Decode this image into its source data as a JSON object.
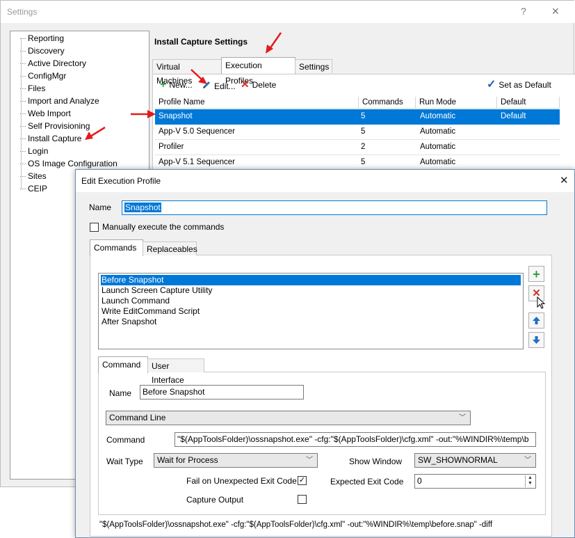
{
  "settings_window": {
    "title": "Settings",
    "help_glyph": "?",
    "close_glyph": "✕",
    "tree_items": [
      {
        "label": "Reporting"
      },
      {
        "label": "Discovery"
      },
      {
        "label": "Active Directory"
      },
      {
        "label": "ConfigMgr"
      },
      {
        "label": "Files"
      },
      {
        "label": "Import and Analyze"
      },
      {
        "label": "Web Import"
      },
      {
        "label": "Self Provisioning"
      },
      {
        "label": "Install Capture"
      },
      {
        "label": "Login"
      },
      {
        "label": "OS Image Configuration"
      },
      {
        "label": "Sites"
      },
      {
        "label": "CEIP"
      }
    ],
    "section_title": "Install Capture Settings",
    "tabs": [
      {
        "label": "Virtual Machines"
      },
      {
        "label": "Execution Profiles"
      },
      {
        "label": "Settings"
      }
    ],
    "toolbar": {
      "new_label": "New...",
      "edit_label": "Edit...",
      "delete_label": "Delete",
      "set_default_label": "Set as Default"
    },
    "grid": {
      "columns": [
        "Profile Name",
        "Commands",
        "Run Mode",
        "Default"
      ],
      "rows": [
        {
          "name": "Snapshot",
          "commands": "5",
          "run_mode": "Automatic",
          "default": "Default"
        },
        {
          "name": "App-V 5.0 Sequencer",
          "commands": "5",
          "run_mode": "Automatic",
          "default": ""
        },
        {
          "name": "Profiler",
          "commands": "2",
          "run_mode": "Automatic",
          "default": ""
        },
        {
          "name": "App-V 5.1 Sequencer",
          "commands": "5",
          "run_mode": "Automatic",
          "default": ""
        }
      ]
    }
  },
  "dialog": {
    "title": "Edit Execution Profile",
    "close_glyph": "✕",
    "name_label": "Name",
    "name_value": "Snapshot",
    "manual_label": "Manually execute the commands",
    "tabs": [
      {
        "label": "Commands"
      },
      {
        "label": "Replaceables"
      }
    ],
    "commands": [
      {
        "label": "Before Snapshot"
      },
      {
        "label": "Launch Screen Capture Utility"
      },
      {
        "label": "Launch Command"
      },
      {
        "label": "Write EditCommand Script"
      },
      {
        "label": "After Snapshot"
      }
    ],
    "sub_tabs": [
      {
        "label": "Command"
      },
      {
        "label": "User Interface"
      }
    ],
    "command_name_label": "Name",
    "command_name_value": "Before Snapshot",
    "command_type_value": "Command Line",
    "command_label": "Command",
    "command_value": "\"$(AppToolsFolder)\\ossnapshot.exe\" -cfg:\"$(AppToolsFolder)\\cfg.xml\" -out:\"%WINDIR%\\temp\\b",
    "wait_type_label": "Wait Type",
    "wait_type_value": "Wait for Process",
    "show_window_label": "Show Window",
    "show_window_value": "SW_SHOWNORMAL",
    "fail_label": "Fail on Unexpected Exit Code",
    "expected_exit_label": "Expected Exit Code",
    "expected_exit_value": "0",
    "capture_output_label": "Capture Output",
    "preview": "\"$(AppToolsFolder)\\ossnapshot.exe\" -cfg:\"$(AppToolsFolder)\\cfg.xml\" -out:\"%WINDIR%\\temp\\before.snap\" -diff"
  },
  "colors": {
    "selection": "#0078d7",
    "annotation_arrow": "#e21b1b",
    "add_icon": "#2e9e3e",
    "delete_icon": "#d0312d",
    "move_icon": "#1f6fc5"
  }
}
